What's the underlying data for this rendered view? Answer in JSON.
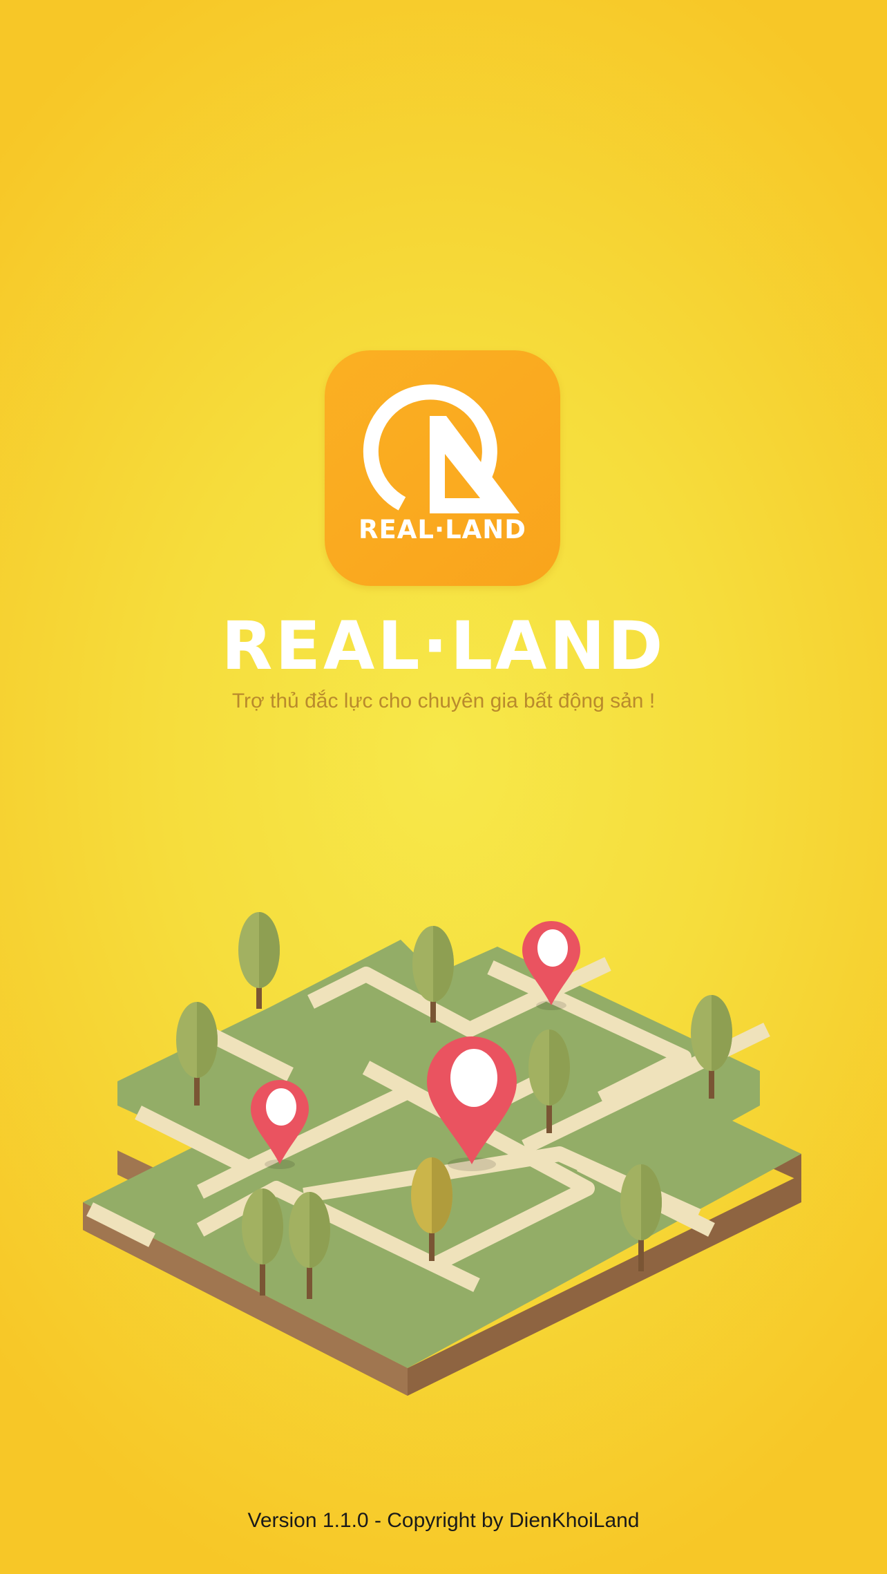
{
  "splash": {
    "icon_label": "REAL·LAND",
    "brand_name": "REAL·LAND",
    "tagline": "Trợ thủ đắc lực cho chuyên gia bất động sản !",
    "footer": "Version 1.1.0 - Copyright by DienKhoiLand"
  },
  "colors": {
    "background": "#f6dd3c",
    "icon_bg": "#fbab20",
    "tagline": "#b98a2c",
    "pin": "#ea5360",
    "grass": "#93ad67",
    "road": "#efe2bb",
    "soil": "#946b47"
  }
}
